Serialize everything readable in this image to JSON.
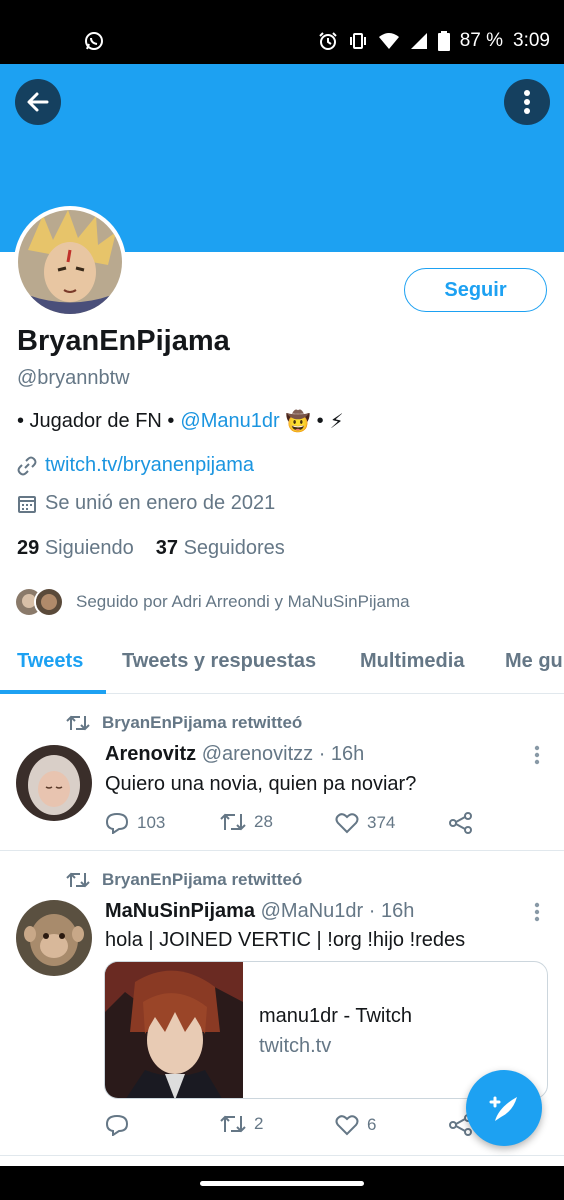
{
  "status_bar": {
    "battery": "87 %",
    "time": "3:09",
    "icons": [
      "whatsapp-icon",
      "alarm-icon",
      "vibrate-icon",
      "wifi-icon",
      "signal-icon",
      "battery-icon"
    ]
  },
  "header": {
    "banner_color": "#1da1f2",
    "back_icon": "arrow-left-icon",
    "more_icon": "more-vertical-icon"
  },
  "profile": {
    "follow_label": "Seguir",
    "name": "BryanEnPijama",
    "handle": "@bryannbtw",
    "bio_prefix": "• Jugador de FN  •",
    "bio_mention": "@Manu1dr",
    "bio_suffix": "•",
    "bio_emoji_1": "🤠",
    "bio_emoji_2": "⚡",
    "link": "twitch.tv/bryanenpijama",
    "joined": "Se unió en enero de 2021",
    "following_count": "29",
    "following_label": "Siguiendo",
    "followers_count": "37",
    "followers_label": "Seguidores",
    "followed_by": "Seguido por Adri Arreondi y MaNuSinPijama"
  },
  "tabs": [
    {
      "label": "Tweets",
      "active": true
    },
    {
      "label": "Tweets y respuestas",
      "active": false
    },
    {
      "label": "Multimedia",
      "active": false
    },
    {
      "label": "Me gu",
      "active": false
    }
  ],
  "tweets": [
    {
      "retweeted_by": "BryanEnPijama retwitteó",
      "author": "Arenovitz",
      "handle": "@arenovitzz · 16h",
      "text": "Quiero una novia, quien pa noviar?",
      "replies": "103",
      "retweets": "28",
      "likes": "374"
    },
    {
      "retweeted_by": "BryanEnPijama retwitteó",
      "author": "MaNuSinPijama",
      "handle": "@MaNu1dr · 16h",
      "text": "hola  | JOINED VERTIC | !org !hijo !redes",
      "card_title": "manu1dr - Twitch",
      "card_domain": "twitch.tv",
      "replies": "",
      "retweets": "2",
      "likes": "6"
    }
  ],
  "fab": {
    "icon": "compose-tweet-icon"
  },
  "colors": {
    "accent": "#1da1f2",
    "secondary_text": "#657786",
    "link": "#1b95e0"
  }
}
